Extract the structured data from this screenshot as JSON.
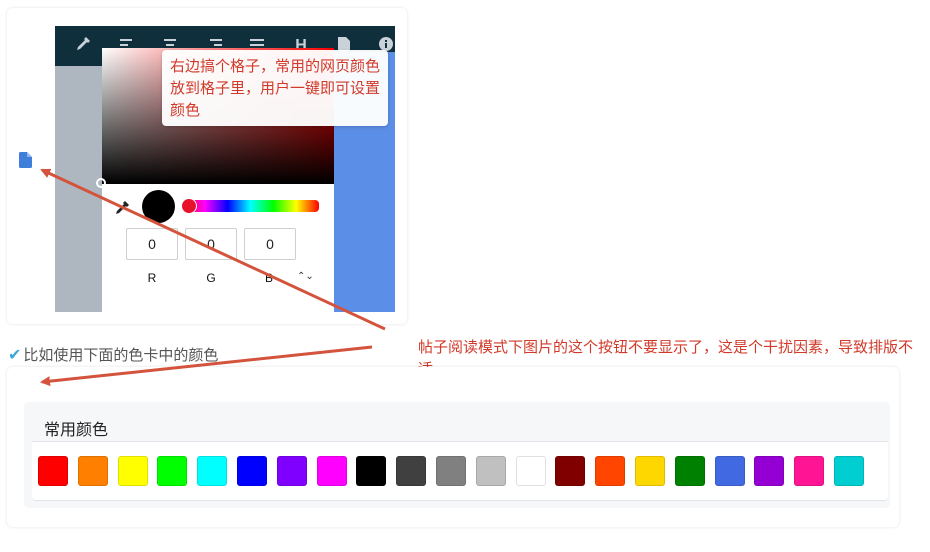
{
  "annotations": {
    "note_top": "右边搞个格子，常用的网页颜色放到格子里，用户一键即可设置颜色",
    "note_bottom": "帖子阅读模式下图片的这个按钮不要显示了，这是个干扰因素，导致排版不适。",
    "arrow_color": "#d4533c"
  },
  "caption": {
    "check_icon": "check-icon",
    "text": "比如使用下面的色卡中的颜色"
  },
  "editor": {
    "toolbar_icons": [
      "eyedropper-icon",
      "align-left-icon",
      "align-center-icon",
      "align-right-icon",
      "align-justify-icon",
      "heading-icon",
      "file-icon",
      "info-icon"
    ],
    "heading_glyph": "H"
  },
  "color_picker": {
    "preview_color": "#000000",
    "hue_color": "#ff0000",
    "r": "0",
    "g": "0",
    "b": "0",
    "label_r": "R",
    "label_g": "G",
    "label_b": "B",
    "toggle_glyph": "⌃⌄"
  },
  "palette": {
    "title": "常用颜色",
    "colors": [
      "#ff0000",
      "#ff8000",
      "#ffff00",
      "#00ff00",
      "#00ffff",
      "#0000ff",
      "#8000ff",
      "#ff00ff",
      "#000000",
      "#404040",
      "#808080",
      "#c0c0c0",
      "#ffffff",
      "#800000",
      "#ff4500",
      "#ffd700",
      "#008000",
      "#4169e1",
      "#9400d3",
      "#ff1493",
      "#00ced1"
    ]
  }
}
